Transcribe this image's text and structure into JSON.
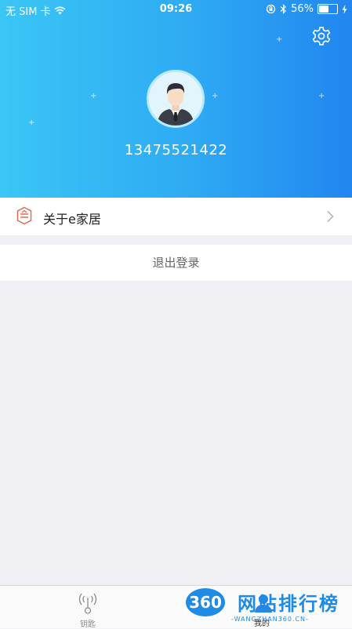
{
  "status_bar": {
    "carrier": "无 SIM 卡",
    "time": "09:26",
    "battery": "56%",
    "battery_level": 0.56
  },
  "profile": {
    "phone": "13475521422"
  },
  "menu": {
    "about_label": "关于e家居",
    "logout_label": "退出登录"
  },
  "tabbar": {
    "tabs": [
      {
        "label": "钥匙",
        "icon": "key-signal-icon"
      },
      {
        "label": "我的",
        "icon": "person-icon"
      }
    ]
  },
  "watermark": {
    "logo": "360",
    "title": "网站排行榜",
    "subtitle": "-WANGZHAN360.CN-"
  },
  "colors": {
    "header_start": "#3bc6f6",
    "header_end": "#2186f0",
    "background": "#efeff4",
    "watermark": "#1e8be6"
  }
}
